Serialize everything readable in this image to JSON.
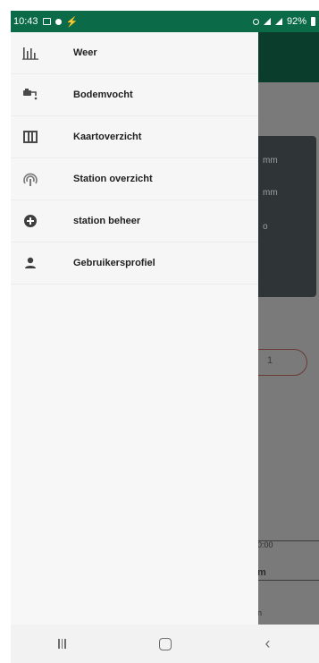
{
  "status_bar": {
    "time": "10:43",
    "battery": "92%"
  },
  "background": {
    "card_lines": [
      "mm",
      "mm",
      "o"
    ],
    "pill_text": "1",
    "small_text_1": "0:00",
    "small_text_2": "m",
    "small_text_3": "n"
  },
  "drawer": {
    "items": [
      {
        "label": "Weer",
        "icon": "bar-chart-icon"
      },
      {
        "label": "Bodemvocht",
        "icon": "tap-icon"
      },
      {
        "label": "Kaartoverzicht",
        "icon": "map-icon"
      },
      {
        "label": "Station overzicht",
        "icon": "broadcast-icon"
      },
      {
        "label": "station beheer",
        "icon": "add-circle-icon"
      },
      {
        "label": "Gebruikersprofiel",
        "icon": "person-icon"
      }
    ]
  },
  "navbar": {
    "recent": "recent-apps",
    "home": "home",
    "back": "back"
  }
}
